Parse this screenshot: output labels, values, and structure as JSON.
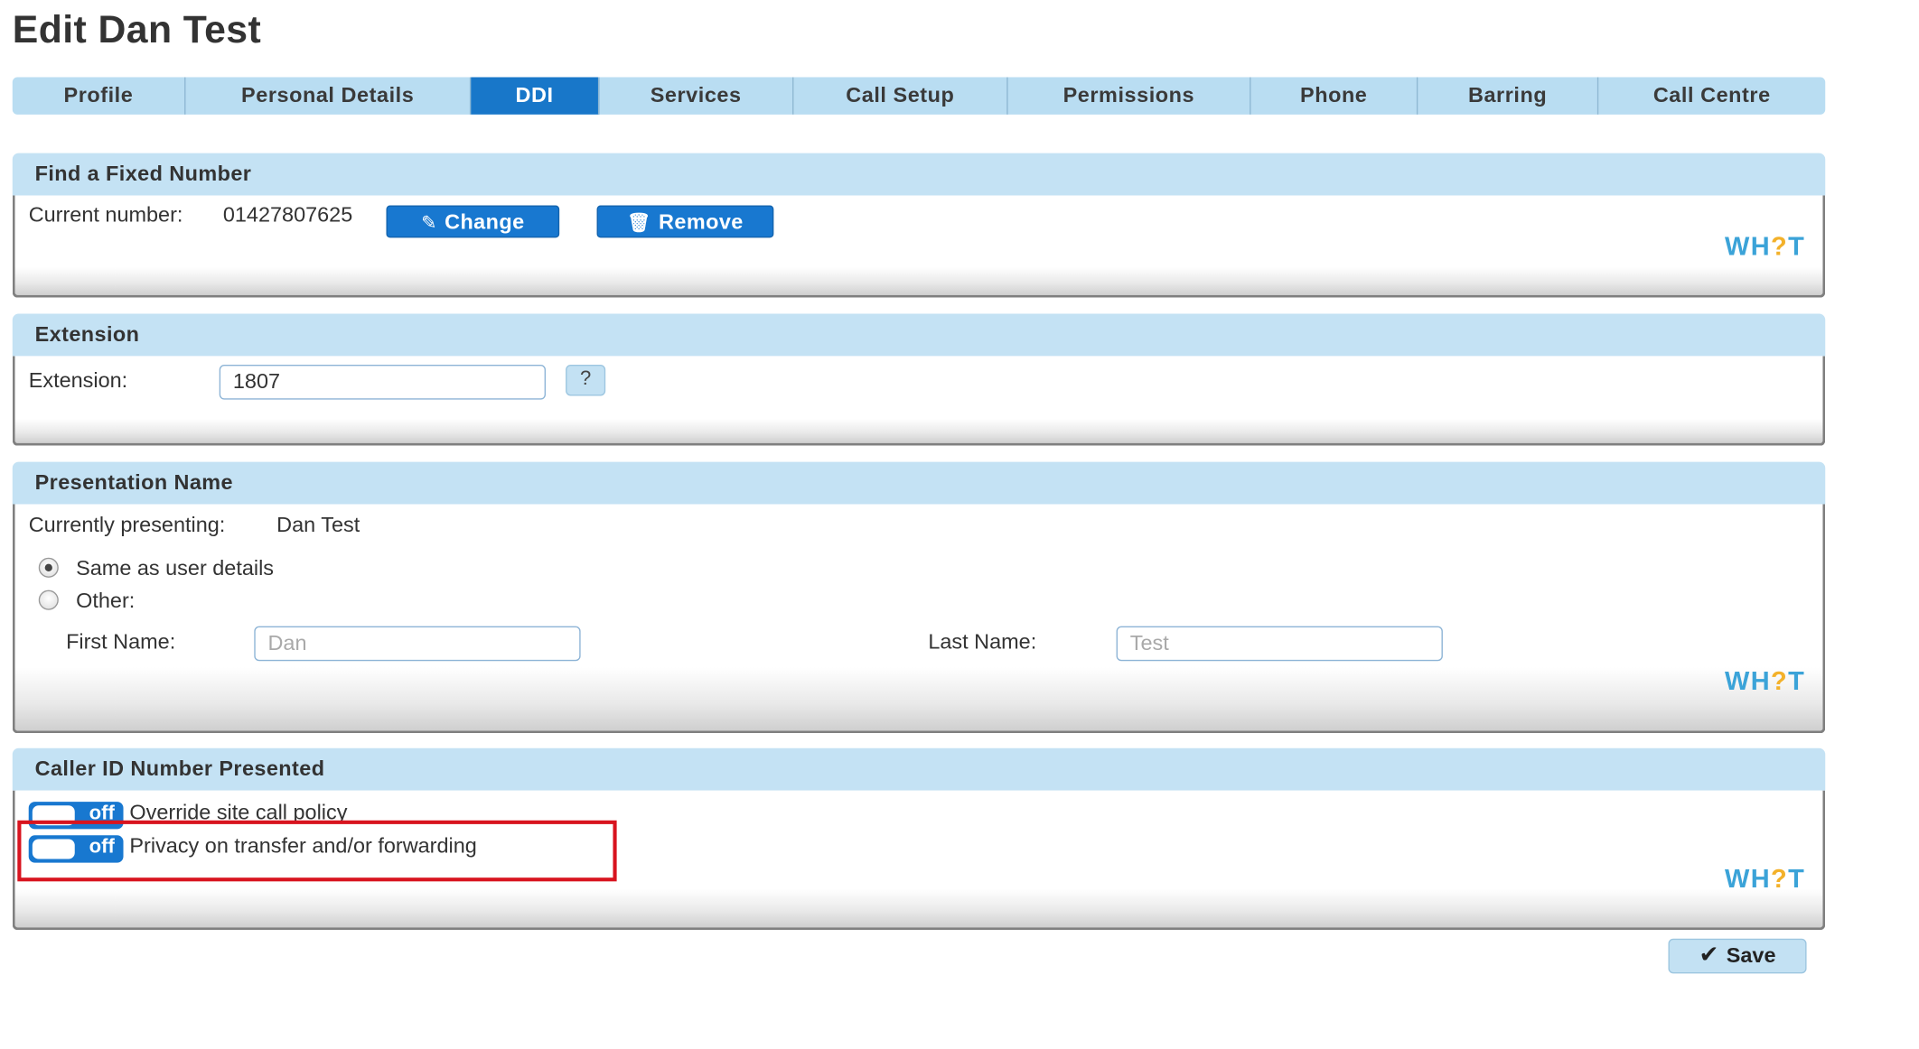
{
  "page": {
    "title": "Edit Dan Test"
  },
  "tabs": [
    {
      "label": "Profile"
    },
    {
      "label": "Personal Details"
    },
    {
      "label": "DDI"
    },
    {
      "label": "Services"
    },
    {
      "label": "Call Setup"
    },
    {
      "label": "Permissions"
    },
    {
      "label": "Phone"
    },
    {
      "label": "Barring"
    },
    {
      "label": "Call Centre"
    }
  ],
  "active_tab": "DDI",
  "find_number": {
    "header": "Find a Fixed Number",
    "current_label": "Current number:",
    "current_value": "01427807625",
    "change_label": "Change",
    "remove_label": "Remove",
    "change_icon": "pencil-icon",
    "remove_icon": "trash-icon"
  },
  "extension": {
    "header": "Extension",
    "label": "Extension:",
    "value": "1807",
    "help_label": "?"
  },
  "presentation": {
    "header": "Presentation Name",
    "currently_label": "Currently presenting:",
    "currently_value": "Dan Test",
    "option_same": "Same as user details",
    "option_other": "Other:",
    "selected_option": "Same as user details",
    "first_name_label": "First Name:",
    "first_name_value": "Dan",
    "last_name_label": "Last Name:",
    "last_name_value": "Test"
  },
  "caller_id": {
    "header": "Caller ID Number Presented",
    "override": {
      "toggle_label": "off",
      "label": "Override site call policy"
    },
    "privacy": {
      "toggle_label": "off",
      "label": "Privacy on transfer and/or forwarding"
    }
  },
  "help_logo": {
    "prefix": "WH",
    "mark": "?",
    "suffix": "T"
  },
  "save_label": "Save",
  "colors": {
    "tab_bg": "#b9ddf2",
    "tab_active": "#1877c9",
    "panel_header": "#c4e2f4",
    "button_blue": "#1878d0",
    "logo_blue": "#3ba3d8",
    "logo_accent": "#f3b12a",
    "highlight": "#d8141f"
  }
}
